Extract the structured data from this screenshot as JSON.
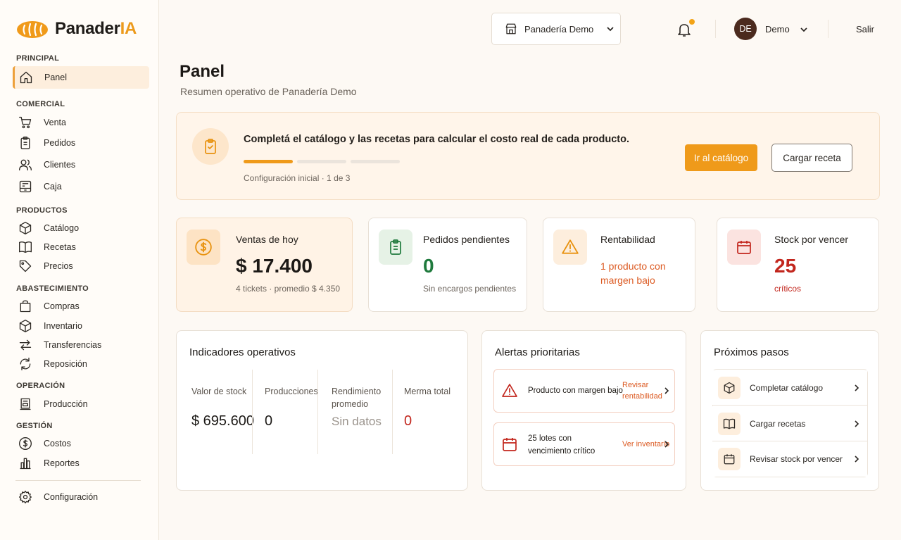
{
  "app": {
    "brand_prefix": "Panader",
    "brand_suffix": "IA"
  },
  "sidebar": {
    "sections": [
      {
        "title": "PRINCIPAL",
        "items": [
          {
            "label": "Panel",
            "icon": "home-icon",
            "active": true
          }
        ]
      },
      {
        "title": "COMERCIAL",
        "items": [
          {
            "label": "Venta",
            "icon": "cart-icon"
          },
          {
            "label": "Pedidos",
            "icon": "clipboard-icon"
          },
          {
            "label": "Clientes",
            "icon": "users-icon"
          },
          {
            "label": "Caja",
            "icon": "cash-register-icon"
          }
        ]
      },
      {
        "title": "PRODUCTOS",
        "items": [
          {
            "label": "Catálogo",
            "icon": "box-icon"
          },
          {
            "label": "Recetas",
            "icon": "book-icon"
          },
          {
            "label": "Precios",
            "icon": "tag-icon"
          }
        ]
      },
      {
        "title": "ABASTECIMIENTO",
        "items": [
          {
            "label": "Compras",
            "icon": "bag-icon"
          },
          {
            "label": "Inventario",
            "icon": "box-icon"
          },
          {
            "label": "Transferencias",
            "icon": "transfer-icon"
          },
          {
            "label": "Reposición",
            "icon": "refresh-icon"
          }
        ]
      },
      {
        "title": "OPERACIÓN",
        "items": [
          {
            "label": "Producción",
            "icon": "oven-icon"
          }
        ]
      },
      {
        "title": "GESTIÓN",
        "items": [
          {
            "label": "Costos",
            "icon": "dollar-icon"
          },
          {
            "label": "Reportes",
            "icon": "bar-chart-icon"
          }
        ]
      }
    ],
    "settings": {
      "label": "Configuración",
      "icon": "gear-icon"
    }
  },
  "topbar": {
    "store_selector": "Panadería Demo",
    "user": {
      "initials": "DE",
      "name": "Demo"
    },
    "logout": "Salir"
  },
  "page": {
    "title": "Panel",
    "subtitle": "Resumen operativo de Panadería Demo"
  },
  "banner": {
    "message": "Completá el catálogo y las recetas para calcular el costo real de cada producto.",
    "progress_note": "Configuración inicial · 1 de 3",
    "progress": {
      "done": 1,
      "total": 3
    },
    "primary_button": "Ir al catálogo",
    "secondary_button": "Cargar receta"
  },
  "stats": [
    {
      "title": "Ventas de hoy",
      "value": "$ 17.400",
      "note": "4 tickets · promedio $ 4.350",
      "icon": "dollar-icon"
    },
    {
      "title": "Pedidos pendientes",
      "value": "0",
      "note": "Sin encargos pendientes",
      "icon": "clipboard-icon"
    },
    {
      "title": "Rentabilidad",
      "value": "1 producto con margen bajo",
      "icon": "warning-icon"
    },
    {
      "title": "Stock por vencer",
      "value": "25",
      "note": "críticos",
      "icon": "calendar-icon"
    }
  ],
  "indicators": {
    "title": "Indicadores operativos",
    "items": [
      {
        "label": "Valor de stock",
        "value": "$ 695.600"
      },
      {
        "label": "Producciones",
        "value": "0"
      },
      {
        "label": "Rendimiento promedio",
        "value": "Sin datos"
      },
      {
        "label": "Merma total",
        "value": "0"
      }
    ]
  },
  "alerts": {
    "title": "Alertas prioritarias",
    "items": [
      {
        "text": "Producto con margen bajo",
        "link": "Revisar rentabilidad",
        "icon": "warning-icon"
      },
      {
        "text": "25 lotes con vencimiento crítico",
        "link": "Ver inventario",
        "icon": "calendar-icon"
      }
    ]
  },
  "next_steps": {
    "title": "Próximos pasos",
    "items": [
      {
        "label": "Completar catálogo",
        "icon": "box-icon"
      },
      {
        "label": "Cargar recetas",
        "icon": "book-icon"
      },
      {
        "label": "Revisar stock por vencer",
        "icon": "calendar-icon"
      }
    ]
  },
  "colors": {
    "accent": "#ef9a1a",
    "success": "#1f7a3d",
    "danger": "#c2261d",
    "warning_text": "#dc5a22"
  }
}
